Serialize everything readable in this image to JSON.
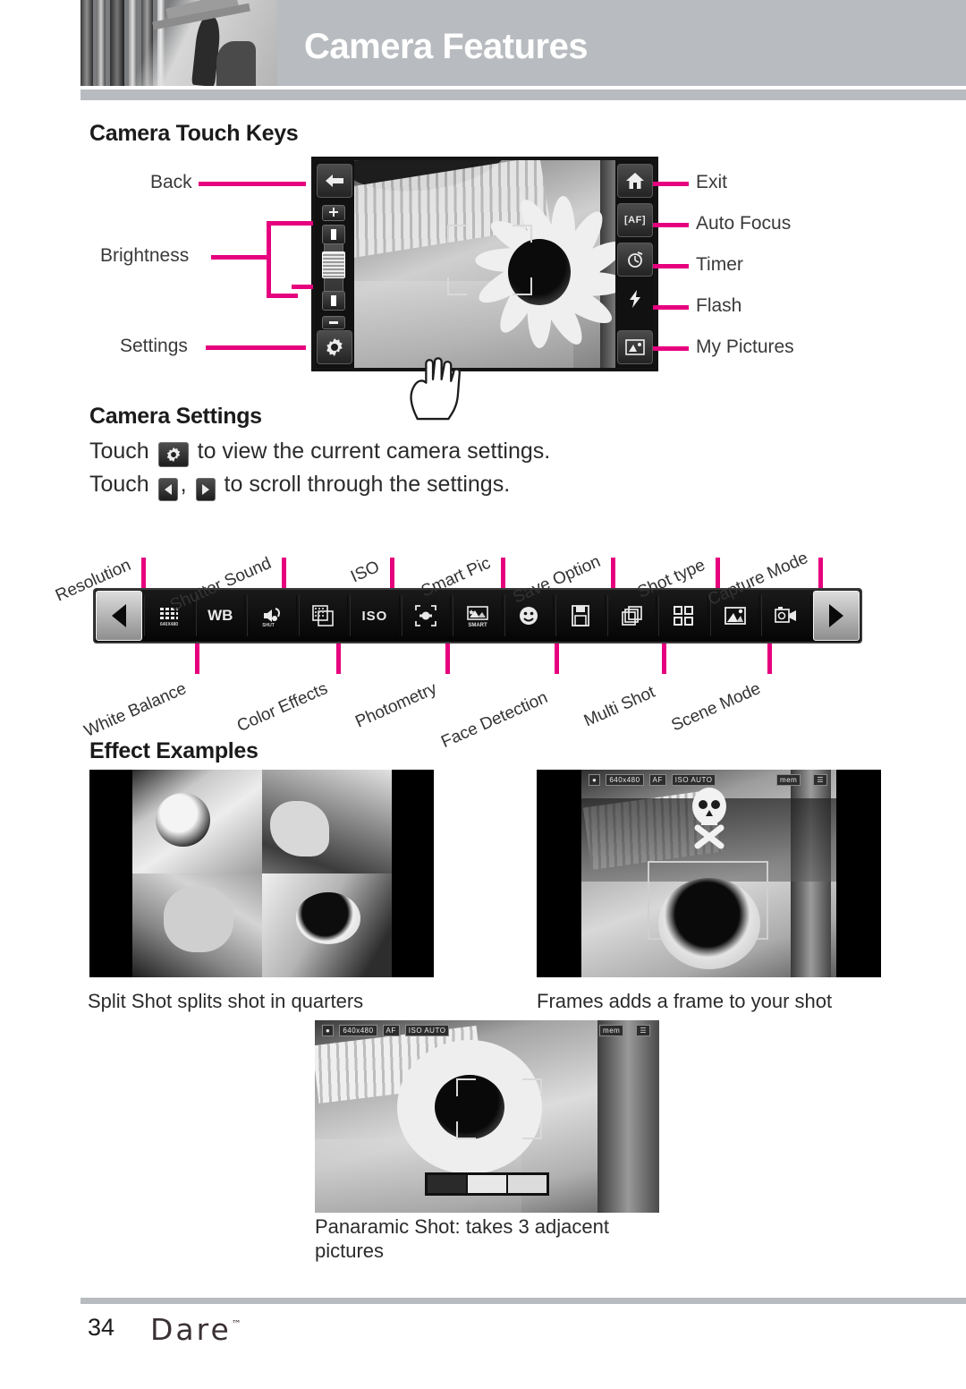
{
  "header": {
    "title": "Camera Features",
    "band_color": "#b8bbbf"
  },
  "accent_color": "#e6007e",
  "sections": {
    "touch_keys_title": "Camera Touch Keys",
    "camera_settings_title": "Camera Settings",
    "effect_examples_title": "Effect Examples"
  },
  "touch_keys": {
    "left_labels": [
      {
        "label": "Back",
        "icon": "back-arrow-icon"
      },
      {
        "label": "Brightness",
        "icon": "brightness-slider-icon"
      },
      {
        "label": "Settings",
        "icon": "gear-icon"
      }
    ],
    "right_labels": [
      {
        "label": "Exit",
        "icon": "home-icon"
      },
      {
        "label": "Auto Focus",
        "icon": "af-icon"
      },
      {
        "label": "Timer",
        "icon": "timer-icon"
      },
      {
        "label": "Flash",
        "icon": "flash-icon"
      },
      {
        "label": "My Pictures",
        "icon": "my-pictures-icon"
      }
    ],
    "keys": {
      "back": "←",
      "plus": "+",
      "minus": "−",
      "af": "AF",
      "home": "⌂",
      "timer": "⏱",
      "flash": "⚡",
      "pictures": "ὛB"
    }
  },
  "camera_settings": {
    "line1_pre": "Touch",
    "line1_post": "to view the current camera settings.",
    "line1_icon": "gear-icon",
    "line2_pre": "Touch",
    "line2_mid": ",",
    "line2_post": "to scroll through the settings.",
    "line2_icon_left": "caret-left-icon",
    "line2_icon_right": "caret-right-icon"
  },
  "toolbar": {
    "prev_label": "◀",
    "next_label": "▶",
    "items": [
      {
        "label": "Resolution",
        "icon": "resolution-icon",
        "side": "top",
        "glyph": ""
      },
      {
        "label": "White Balance",
        "icon": "white-balance-icon",
        "side": "bottom",
        "glyph": "WB"
      },
      {
        "label": "Shutter Sound",
        "icon": "shutter-sound-icon",
        "side": "top",
        "glyph": ""
      },
      {
        "label": "Color Effects",
        "icon": "color-effects-icon",
        "side": "bottom",
        "glyph": ""
      },
      {
        "label": "ISO",
        "icon": "iso-icon",
        "side": "top",
        "glyph": "ISO"
      },
      {
        "label": "Photometry",
        "icon": "photometry-icon",
        "side": "bottom",
        "glyph": ""
      },
      {
        "label": "Smart Pic",
        "icon": "smart-pic-icon",
        "side": "top",
        "glyph": "SMART"
      },
      {
        "label": "Face Detection",
        "icon": "face-detection-icon",
        "side": "bottom",
        "glyph": ""
      },
      {
        "label": "Save Option",
        "icon": "save-option-icon",
        "side": "top",
        "glyph": ""
      },
      {
        "label": "Multi Shot",
        "icon": "multi-shot-icon",
        "side": "bottom",
        "glyph": ""
      },
      {
        "label": "Shot type",
        "icon": "shot-type-icon",
        "side": "top",
        "glyph": ""
      },
      {
        "label": "Scene Mode",
        "icon": "scene-mode-icon",
        "side": "bottom",
        "glyph": ""
      },
      {
        "label": "Capture Mode",
        "icon": "capture-mode-icon",
        "side": "top",
        "glyph": ""
      }
    ]
  },
  "effect_examples": [
    {
      "caption": "Split Shot splits shot in quarters",
      "name": "split-shot-example"
    },
    {
      "caption": "Frames adds a frame to your shot",
      "name": "frames-example"
    },
    {
      "caption": "Panaramic Shot: takes 3 adjacent pictures",
      "name": "panoramic-shot-example"
    }
  ],
  "osd": {
    "chip1": "640x480",
    "chip2": "AF",
    "chip3": "ISO AUTO",
    "chip_mem": "mem",
    "chip_signal": "signal"
  },
  "footer": {
    "page_number": "34",
    "brand": "Dare",
    "trademark": "™"
  }
}
